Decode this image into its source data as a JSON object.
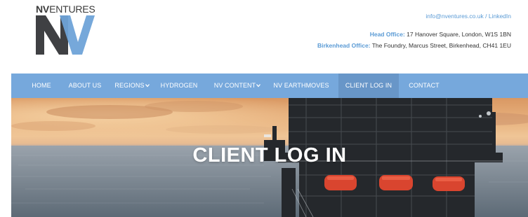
{
  "logo": {
    "word_bold": "NV",
    "word_light": "ENTURES",
    "mark_icon": "nv-monogram-logo"
  },
  "contact": {
    "email": "info@nventures.co.uk",
    "separator": "/",
    "linkedin": "LinkedIn"
  },
  "addresses": [
    {
      "label": "Head Office:",
      "text": " 17 Hanover Square, London, W1S 1BN"
    },
    {
      "label": "Birkenhead Office:",
      "text": " The Foundry, Marcus Street, Birkenhead, CH41 1EU"
    }
  ],
  "nav": {
    "items": [
      {
        "label": "HOME"
      },
      {
        "label": "ABOUT US"
      },
      {
        "label": "REGIONS",
        "dropdown_icon": "chevron-down-icon"
      },
      {
        "label": "HYDROGEN"
      },
      {
        "label": "NV CONTENT",
        "dropdown_icon": "chevron-down-icon"
      },
      {
        "label": "NV EARTHMOVES"
      },
      {
        "label": "CLIENT LOG IN",
        "active": true
      },
      {
        "label": "CONTACT"
      }
    ]
  },
  "hero": {
    "title": "CLIENT LOG IN",
    "image": "offshore-oil-platform-at-sunset"
  },
  "colors": {
    "accent": "#5b9bd5",
    "nav_bg": "#76a8dc",
    "nav_active": "#6896c8",
    "logo_dark": "#3f4043",
    "logo_blue": "#6fa3d8"
  }
}
